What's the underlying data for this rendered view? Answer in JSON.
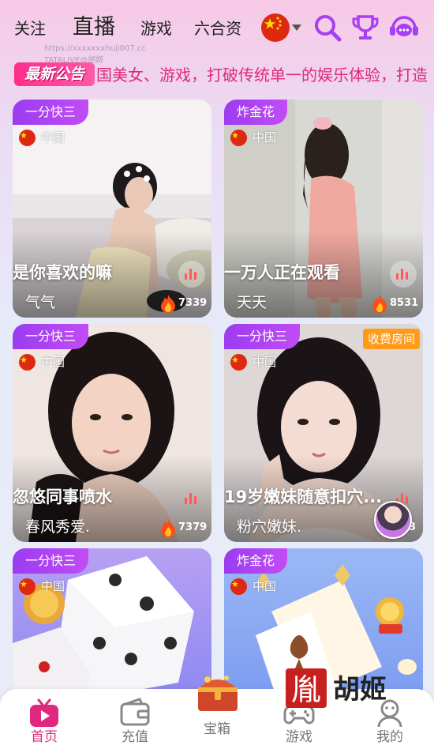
{
  "nav": {
    "tabs": [
      "关注",
      "直播",
      "游戏",
      "六合资"
    ],
    "active_tab": "直播",
    "country_flag": "china-flag-icon",
    "icons": [
      "search-icon",
      "trophy-icon",
      "customer-service-icon"
    ]
  },
  "watermark": {
    "line1": "https://xxxxxxxhuji007.cc",
    "line2": "TATALIVE@胡姬"
  },
  "announcement": {
    "badge": "最新公告",
    "text": "国美女、游戏，打破传统单一的娱乐体验，打造"
  },
  "cards": [
    {
      "badge": "一分快三",
      "country": "中国",
      "title": "是你喜欢的嘛",
      "host": "气气",
      "viewers": "7339",
      "paid": ""
    },
    {
      "badge": "炸金花",
      "country": "中国",
      "title": "一万人正在观看",
      "host": "天天",
      "viewers": "8531",
      "paid": ""
    },
    {
      "badge": "一分快三",
      "country": "中国",
      "title": "忽悠同事喷水",
      "host": "春风秀爱.",
      "viewers": "7379",
      "paid": ""
    },
    {
      "badge": "一分快三",
      "country": "中国",
      "title": "19岁嫩妹随意扣穴...",
      "host": "粉穴嫩妹.",
      "viewers": "3",
      "paid": "收费房间"
    },
    {
      "badge": "一分快三",
      "country": "中国",
      "title": "",
      "host": "",
      "viewers": "",
      "paid": ""
    },
    {
      "badge": "炸金花",
      "country": "中国",
      "title": "",
      "host": "",
      "viewers": "",
      "paid": ""
    }
  ],
  "tabbar": {
    "items": [
      {
        "label": "首页",
        "icon": "home-live-icon",
        "active": true
      },
      {
        "label": "充值",
        "icon": "wallet-icon",
        "active": false
      },
      {
        "label": "宝箱",
        "icon": "treasure-chest-icon",
        "active": false
      },
      {
        "label": "游戏",
        "icon": "gamepad-icon",
        "active": false
      },
      {
        "label": "我的",
        "icon": "profile-icon",
        "active": false
      }
    ]
  },
  "brand": {
    "seal": "胤",
    "name": "胡姬"
  },
  "colors": {
    "accent": "#e0287e",
    "badge_purple": "#a640f2",
    "paid_orange": "#ff9a1a",
    "china_red": "#de2910"
  }
}
